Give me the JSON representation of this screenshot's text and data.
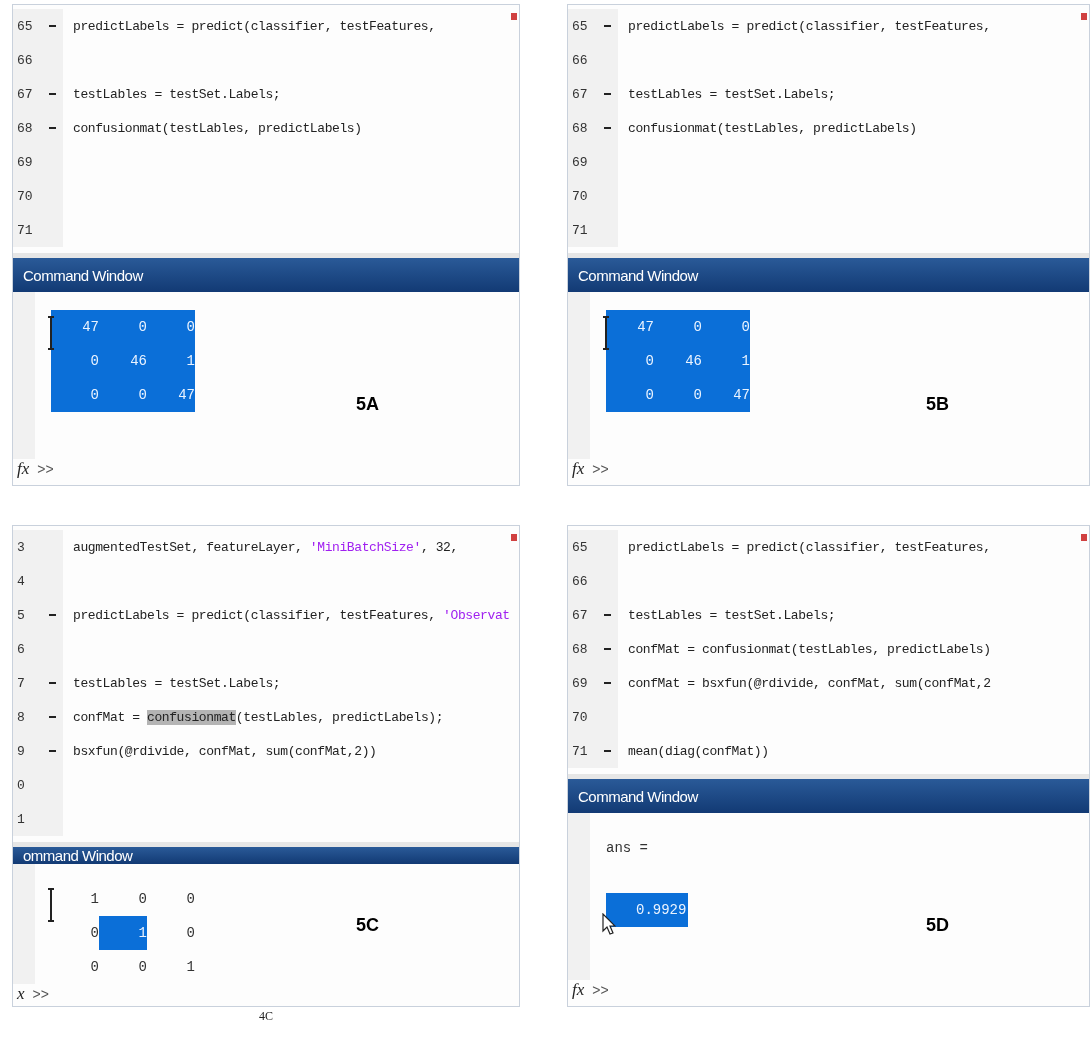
{
  "panels": [
    {
      "label": "5A",
      "editor": {
        "lines": [
          {
            "number": "65",
            "executable": true,
            "warning": true,
            "segments": [
              {
                "kind": "code",
                "text": "predictLabels = predict(classifier, testFeatures,"
              }
            ]
          },
          {
            "number": "66",
            "executable": false,
            "warning": false
          },
          {
            "number": "67",
            "executable": true,
            "warning": false,
            "segments": [
              {
                "kind": "code",
                "text": "testLables = testSet.Labels;"
              }
            ]
          },
          {
            "number": "68",
            "executable": true,
            "warning": false,
            "segments": [
              {
                "kind": "code",
                "text": "confusionmat(testLables, predictLabels)"
              }
            ]
          },
          {
            "number": "69",
            "executable": false,
            "warning": false
          },
          {
            "number": "70",
            "executable": false,
            "warning": false
          },
          {
            "number": "71",
            "executable": false,
            "warning": false
          }
        ]
      },
      "command_window": {
        "title": "Command Window",
        "cursor": {
          "kind": "ibeam"
        },
        "output": [
          {
            "kind": "matrix",
            "cells": [
              {
                "text": "47",
                "selected": true
              },
              {
                "text": "0",
                "selected": true
              },
              {
                "text": "0",
                "selected": true
              }
            ]
          },
          {
            "kind": "matrix",
            "cells": [
              {
                "text": "0",
                "selected": true
              },
              {
                "text": "46",
                "selected": true
              },
              {
                "text": "1",
                "selected": true
              }
            ]
          },
          {
            "kind": "matrix",
            "cells": [
              {
                "text": "0",
                "selected": true
              },
              {
                "text": "0",
                "selected": true
              },
              {
                "text": "47",
                "selected": true
              }
            ]
          }
        ],
        "prompt": {
          "fx": "fx",
          "symbol": ">>"
        }
      }
    },
    {
      "label": "5B",
      "editor": {
        "lines": [
          {
            "number": "65",
            "executable": true,
            "warning": true,
            "segments": [
              {
                "kind": "code",
                "text": "predictLabels = predict(classifier, testFeatures,"
              }
            ]
          },
          {
            "number": "66",
            "executable": false,
            "warning": false
          },
          {
            "number": "67",
            "executable": true,
            "warning": false,
            "segments": [
              {
                "kind": "code",
                "text": "testLables = testSet.Labels;"
              }
            ]
          },
          {
            "number": "68",
            "executable": true,
            "warning": false,
            "segments": [
              {
                "kind": "code",
                "text": "confusionmat(testLables, predictLabels)"
              }
            ]
          },
          {
            "number": "69",
            "executable": false,
            "warning": false
          },
          {
            "number": "70",
            "executable": false,
            "warning": false
          },
          {
            "number": "71",
            "executable": false,
            "warning": false
          }
        ]
      },
      "command_window": {
        "title": "Command Window",
        "cursor": {
          "kind": "ibeam"
        },
        "output": [
          {
            "kind": "matrix",
            "cells": [
              {
                "text": "47",
                "selected": true
              },
              {
                "text": "0",
                "selected": true
              },
              {
                "text": "0",
                "selected": true
              }
            ]
          },
          {
            "kind": "matrix",
            "cells": [
              {
                "text": "0",
                "selected": true
              },
              {
                "text": "46",
                "selected": true
              },
              {
                "text": "1",
                "selected": true
              }
            ]
          },
          {
            "kind": "matrix",
            "cells": [
              {
                "text": "0",
                "selected": true
              },
              {
                "text": "0",
                "selected": true
              },
              {
                "text": "47",
                "selected": true
              }
            ]
          }
        ],
        "prompt": {
          "fx": "fx",
          "symbol": ">>"
        }
      }
    },
    {
      "label": "5C",
      "note": "4C",
      "editor": {
        "lines": [
          {
            "number": "3",
            "executable": false,
            "warning": true,
            "segments": [
              {
                "kind": "code",
                "text": "augmentedTestSet, featureLayer, "
              },
              {
                "kind": "string",
                "text": "'MiniBatchSize'"
              },
              {
                "kind": "code",
                "text": ", 32,"
              }
            ]
          },
          {
            "number": "4",
            "executable": false,
            "warning": false
          },
          {
            "number": "5",
            "executable": true,
            "warning": false,
            "segments": [
              {
                "kind": "code",
                "text": "predictLabels = predict(classifier, testFeatures, "
              },
              {
                "kind": "string",
                "text": "'Observat"
              }
            ]
          },
          {
            "number": "6",
            "executable": false,
            "warning": false
          },
          {
            "number": "7",
            "executable": true,
            "warning": false,
            "segments": [
              {
                "kind": "code",
                "text": "testLables = testSet.Labels;"
              }
            ]
          },
          {
            "number": "8",
            "executable": true,
            "warning": false,
            "segments": [
              {
                "kind": "code",
                "text": "confMat = "
              },
              {
                "kind": "highlight",
                "text": "confusionmat"
              },
              {
                "kind": "code",
                "text": "(testLables, predictLabels);"
              }
            ]
          },
          {
            "number": "9",
            "executable": true,
            "warning": false,
            "segments": [
              {
                "kind": "code",
                "text": "bsxfun(@rdivide, confMat, sum(confMat,2))"
              }
            ]
          },
          {
            "number": "0",
            "executable": false,
            "warning": false
          },
          {
            "number": "1",
            "executable": false,
            "warning": false
          }
        ]
      },
      "command_window": {
        "title": "ommand Window",
        "cursor": {
          "kind": "ibeam"
        },
        "output": [
          {
            "kind": "matrix",
            "cells": [
              {
                "text": "1",
                "selected": false
              },
              {
                "text": "0",
                "selected": false
              },
              {
                "text": "0",
                "selected": false
              }
            ]
          },
          {
            "kind": "matrix",
            "cells": [
              {
                "text": "0",
                "selected": false
              },
              {
                "text": "1",
                "selected": true
              },
              {
                "text": "0",
                "selected": false
              }
            ]
          },
          {
            "kind": "matrix",
            "cells": [
              {
                "text": "0",
                "selected": false
              },
              {
                "text": "0",
                "selected": false
              },
              {
                "text": "1",
                "selected": false
              }
            ]
          }
        ],
        "prompt": {
          "fx": "x",
          "symbol": ">>"
        }
      }
    },
    {
      "label": "5D",
      "editor": {
        "lines": [
          {
            "number": "65",
            "executable": false,
            "warning": true,
            "segments": [
              {
                "kind": "code",
                "text": "predictLabels = predict(classifier, testFeatures,"
              }
            ]
          },
          {
            "number": "66",
            "executable": false,
            "warning": false
          },
          {
            "number": "67",
            "executable": true,
            "warning": false,
            "segments": [
              {
                "kind": "code",
                "text": "testLables = testSet.Labels;"
              }
            ]
          },
          {
            "number": "68",
            "executable": true,
            "warning": false,
            "segments": [
              {
                "kind": "code",
                "text": "confMat = confusionmat(testLables, predictLabels)"
              }
            ]
          },
          {
            "number": "69",
            "executable": true,
            "warning": false,
            "segments": [
              {
                "kind": "code",
                "text": "confMat = bsxfun(@rdivide, confMat, sum(confMat,2"
              }
            ]
          },
          {
            "number": "70",
            "executable": false,
            "warning": false
          },
          {
            "number": "71",
            "executable": true,
            "warning": false,
            "segments": [
              {
                "kind": "code",
                "text": "mean(diag(confMat))"
              }
            ]
          }
        ]
      },
      "command_window": {
        "title": "Command Window",
        "cursor": {
          "kind": "arrow"
        },
        "output": [
          {
            "kind": "text",
            "cells": [
              {
                "text": "ans =",
                "selected": false
              }
            ]
          },
          {
            "kind": "text",
            "cells": [
              {
                "text": "0.9929",
                "selected": true
              }
            ]
          }
        ],
        "prompt": {
          "fx": "fx",
          "symbol": ">>"
        }
      }
    }
  ]
}
